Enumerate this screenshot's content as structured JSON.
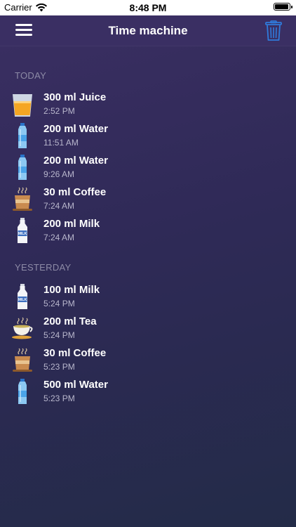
{
  "status_bar": {
    "carrier": "Carrier",
    "time": "8:48 PM"
  },
  "nav": {
    "title": "Time machine",
    "menu_icon": "hamburger-menu-icon",
    "delete_icon": "trash-icon",
    "accent_color": "#2f7bdc"
  },
  "sections": [
    {
      "title": "TODAY",
      "entries": [
        {
          "icon": "juice-glass-icon",
          "title": "300 ml Juice",
          "time": "2:52 PM"
        },
        {
          "icon": "water-bottle-icon",
          "title": "200 ml Water",
          "time": "11:51 AM"
        },
        {
          "icon": "water-bottle-icon",
          "title": "200 ml Water",
          "time": "9:26 AM"
        },
        {
          "icon": "coffee-cup-icon",
          "title": "30 ml Coffee",
          "time": "7:24 AM"
        },
        {
          "icon": "milk-bottle-icon",
          "title": "200 ml Milk",
          "time": "7:24 AM",
          "label": "MILK"
        }
      ]
    },
    {
      "title": "YESTERDAY",
      "entries": [
        {
          "icon": "milk-bottle-icon",
          "title": "100 ml Milk",
          "time": "5:24 PM",
          "label": "MILK"
        },
        {
          "icon": "tea-cup-icon",
          "title": "200 ml Tea",
          "time": "5:24 PM"
        },
        {
          "icon": "coffee-cup-icon",
          "title": "30 ml Coffee",
          "time": "5:23 PM"
        },
        {
          "icon": "water-bottle-icon",
          "title": "500 ml Water",
          "time": "5:23 PM"
        }
      ]
    }
  ]
}
